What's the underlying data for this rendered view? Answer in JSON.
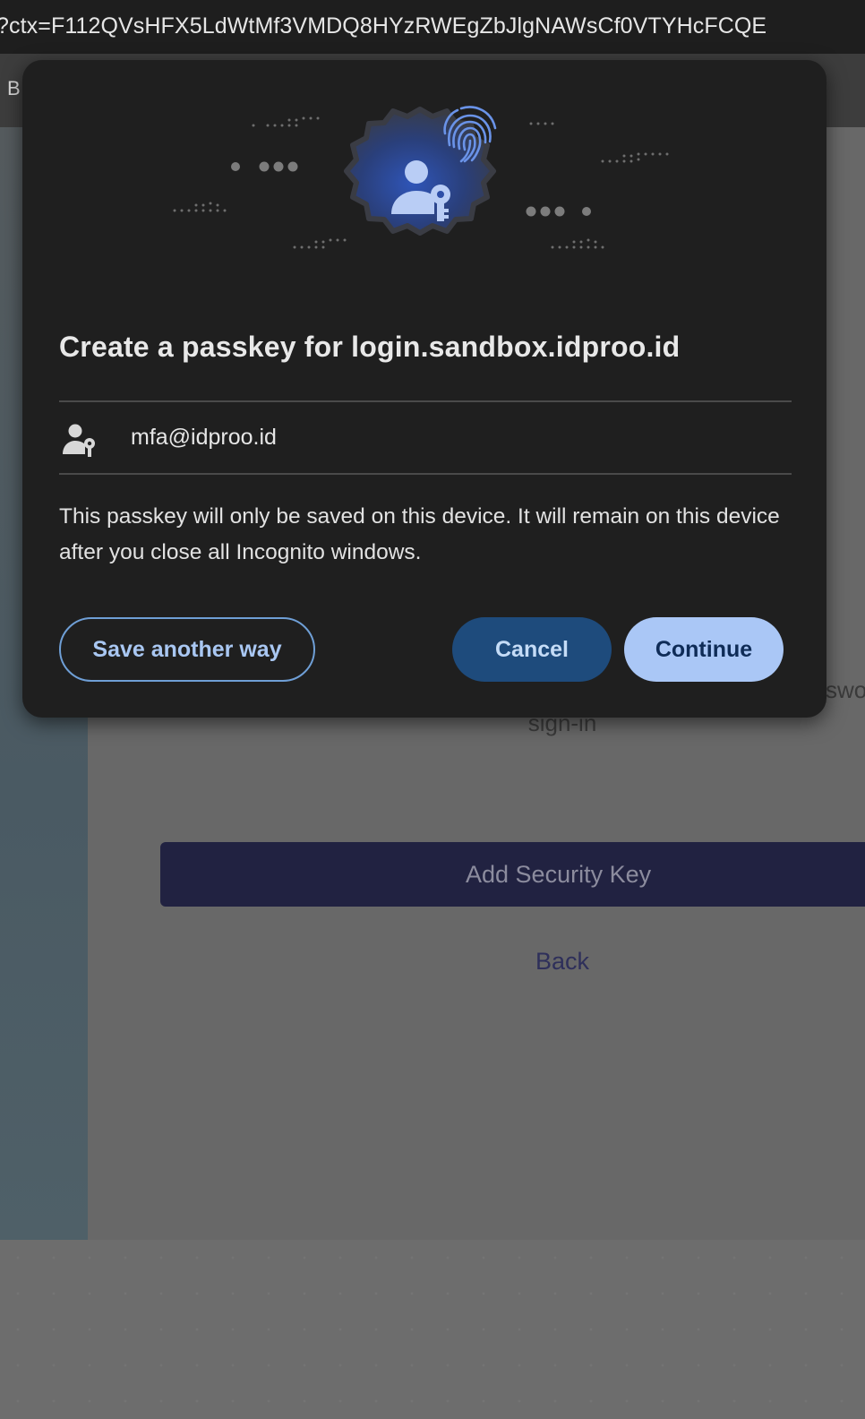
{
  "browser": {
    "url_text": "?ctx=F112QVsHFX5LdWtMf3VMDQ8HYzRWEgZbJlgNAWsCf0VTYHcFCQE",
    "toolbar_letter": "B"
  },
  "page": {
    "partial_password_text": "swo",
    "signin_text": "sign-in",
    "add_security_key_label": "Add Security Key",
    "back_label": "Back"
  },
  "dialog": {
    "illustration_icons": [
      "passkey-badge-icon",
      "person-key-icon",
      "fingerprint-icon"
    ],
    "title": "Create a passkey for login.sandbox.idproo.id",
    "account": {
      "icon": "person-key-icon",
      "email": "mfa@idproo.id"
    },
    "description": "This passkey will only be saved on this device. It will remain on this device after you close all Incognito windows.",
    "buttons": {
      "save_another_way": "Save another way",
      "cancel": "Cancel",
      "continue": "Continue"
    }
  },
  "colors": {
    "dialog_bg": "#1f1f1f",
    "accent_light": "#aac7f6",
    "accent_dark": "#1e4b7c",
    "outline_accent": "#6f9fd6",
    "badge_gradient_start": "#2f55b8",
    "add_key_button_bg": "#212241"
  }
}
